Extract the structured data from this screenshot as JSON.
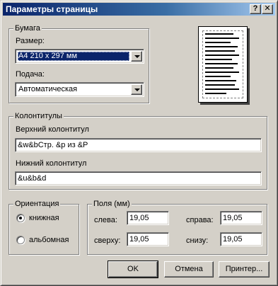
{
  "window": {
    "title": "Параметры страницы",
    "help_label": "?",
    "close_label": "✕"
  },
  "paper": {
    "legend": "Бумага",
    "size_label": "Размер:",
    "size_value": "А4 210 x 297 мм",
    "source_label": "Подача:",
    "source_value": "Автоматическая"
  },
  "headers": {
    "legend": "Колонтитулы",
    "header_label": "Верхний колонтитул",
    "header_value": "&w&bСтр. &p из &P",
    "footer_label": "Нижний колонтитул",
    "footer_value": "&u&b&d"
  },
  "orientation": {
    "legend": "Ориентация",
    "options": [
      {
        "label": "книжная",
        "selected": true
      },
      {
        "label": "альбомная",
        "selected": false
      }
    ]
  },
  "margins": {
    "legend": "Поля (мм)",
    "left_label": "слева:",
    "left_value": "19,05",
    "right_label": "справа:",
    "right_value": "19,05",
    "top_label": "сверху:",
    "top_value": "19,05",
    "bottom_label": "снизу:",
    "bottom_value": "19,05"
  },
  "buttons": {
    "ok": "OK",
    "cancel": "Отмена",
    "printer": "Принтер..."
  },
  "colors": {
    "title_bar": "#0a246a",
    "face": "#d4d0c8",
    "selection": "#0a246a"
  },
  "icons": [
    "help-icon",
    "close-icon",
    "chevron-down-icon",
    "page-preview-icon"
  ]
}
